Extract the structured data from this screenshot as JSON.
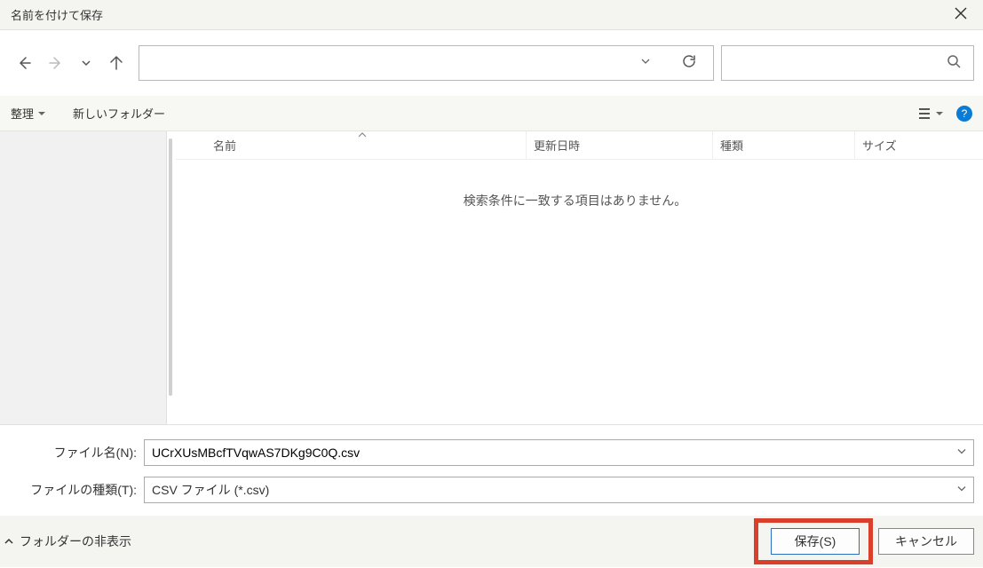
{
  "dialog": {
    "title": "名前を付けて保存"
  },
  "toolbar": {
    "organize_label": "整理",
    "new_folder_label": "新しいフォルダー"
  },
  "columns": {
    "name": "名前",
    "date": "更新日時",
    "type": "種類",
    "size": "サイズ"
  },
  "filelist": {
    "empty_message": "検索条件に一致する項目はありません。"
  },
  "form": {
    "filename_label": "ファイル名(N):",
    "filename_value": "UCrXUsMBcfTVqwAS7DKg9C0Q.csv",
    "filetype_label": "ファイルの種類(T):",
    "filetype_value": "CSV ファイル (*.csv)"
  },
  "footer": {
    "hide_folders_label": "フォルダーの非表示",
    "save_label": "保存(S)",
    "cancel_label": "キャンセル"
  }
}
